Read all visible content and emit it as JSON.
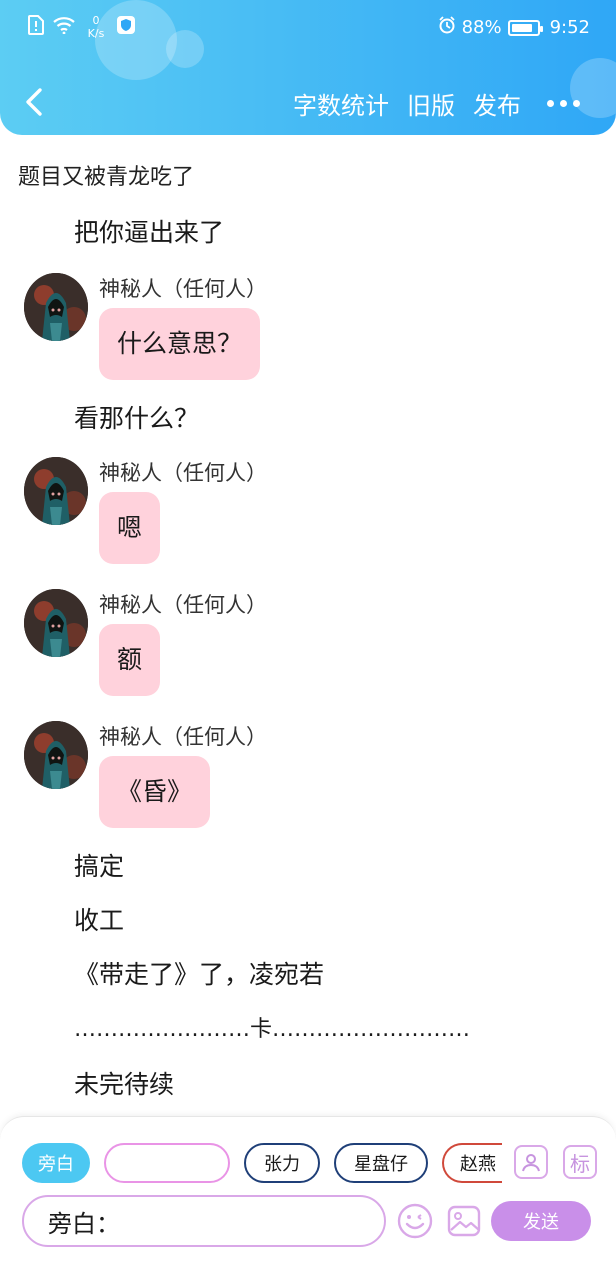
{
  "status_bar": {
    "speed_value": "0",
    "speed_unit": "K/s",
    "battery_percent": "88%",
    "battery_level": 0.88,
    "time": "9:52",
    "icons": [
      "sim-alert-icon",
      "wifi-icon",
      "shield-app-icon",
      "alarm-icon",
      "battery-icon"
    ]
  },
  "navbar": {
    "actions": [
      "字数统计",
      "旧版",
      "发布"
    ],
    "back_icon": "chevron-left-icon",
    "more_icon": "more-dots-icon"
  },
  "doc": {
    "title": "题目又被青龙吃了"
  },
  "messages": [
    {
      "type": "narration",
      "text": "把你逼出来了"
    },
    {
      "type": "character",
      "speaker": "神秘人（任何人）",
      "text": "什么意思？"
    },
    {
      "type": "narration",
      "text": "看那什么？"
    },
    {
      "type": "character",
      "speaker": "神秘人（任何人）",
      "text": "嗯"
    },
    {
      "type": "character",
      "speaker": "神秘人（任何人）",
      "text": "额"
    },
    {
      "type": "character",
      "speaker": "神秘人（任何人）",
      "text": "《昏》"
    },
    {
      "type": "narration",
      "text": "搞定"
    },
    {
      "type": "narration",
      "text": "收工"
    },
    {
      "type": "narration",
      "text": "《带走了》了，凌宛若"
    },
    {
      "type": "narration",
      "text": "……………………卡………………………"
    },
    {
      "type": "narration",
      "text": "未完待续"
    }
  ],
  "composer": {
    "role_chips": [
      "旁白",
      "",
      "张力",
      "星盘仔",
      "赵燕"
    ],
    "active_chip": "旁白",
    "contacts_icon": "person-card-icon",
    "tag_button_label": "标",
    "input_value": "旁白：",
    "emoji_icon": "emoji-icon",
    "image_icon": "image-icon",
    "send_label": "发送"
  },
  "colors": {
    "header_start": "#5ccdf3",
    "header_end": "#2fa7f6",
    "bubble_pink": "#ffd2dc",
    "accent_purple": "#c98fe9",
    "chip_cyan": "#4cc8f2"
  }
}
